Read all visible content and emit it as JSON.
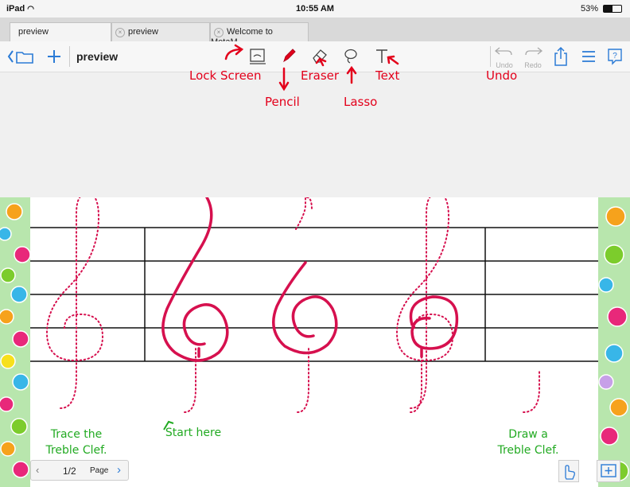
{
  "status": {
    "carrier": "iPad",
    "time": "10:55 AM",
    "battery": "53%"
  },
  "tabs": [
    {
      "label": "preview"
    },
    {
      "label": "preview"
    },
    {
      "label": "Welcome to MetaM..."
    }
  ],
  "toolbar": {
    "title": "preview",
    "undo": "Undo",
    "redo": "Redo"
  },
  "annotations": {
    "lock_screen": "Lock Screen",
    "pencil": "Pencil",
    "eraser": "Eraser",
    "lasso": "Lasso",
    "text": "Text",
    "undo": "Undo"
  },
  "worksheet": {
    "trace": "Trace the",
    "trace2": "Treble Clef.",
    "start": "Start here",
    "draw": "Draw a",
    "draw2": "Treble Clef."
  },
  "pager": {
    "pages": "1/2",
    "page_label": "Page"
  },
  "colors": {
    "accent": "#2b7bd6",
    "annotation": "#e3001b",
    "ink": "#d6104e",
    "guide": "#22aa22"
  }
}
